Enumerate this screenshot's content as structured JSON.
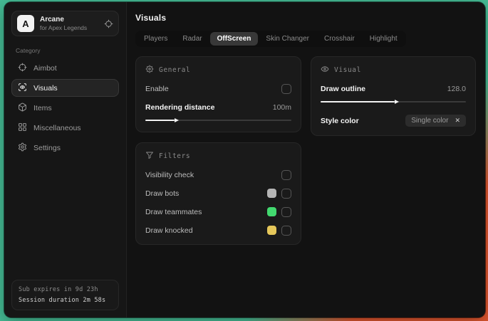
{
  "sidebar": {
    "logo_letter": "A",
    "app_name": "Arcane",
    "app_subtitle": "for Apex Legends",
    "category_label": "Category",
    "items": [
      {
        "label": "Aimbot",
        "icon": "crosshair-icon"
      },
      {
        "label": "Visuals",
        "icon": "scan-eye-icon"
      },
      {
        "label": "Items",
        "icon": "package-icon"
      },
      {
        "label": "Miscellaneous",
        "icon": "grid-icon"
      },
      {
        "label": "Settings",
        "icon": "gear-icon"
      }
    ],
    "footer": {
      "line1": "Sub expires in 9d 23h",
      "line2": "Session duration 2m 58s"
    }
  },
  "main": {
    "title": "Visuals",
    "tabs": [
      {
        "label": "Players"
      },
      {
        "label": "Radar"
      },
      {
        "label": "OffScreen",
        "active": true
      },
      {
        "label": "Skin Changer"
      },
      {
        "label": "Crosshair"
      },
      {
        "label": "Highlight"
      }
    ],
    "general": {
      "title": "General",
      "enable_label": "Enable",
      "enable_checked": false,
      "distance_label": "Rendering distance",
      "distance_value": "100m",
      "distance_percent": 20
    },
    "visual": {
      "title": "Visual",
      "outline_label": "Draw outline",
      "outline_value": "128.0",
      "outline_percent": 51,
      "style_label": "Style color",
      "style_value": "Single color",
      "clear_glyph": "✕"
    },
    "filters": {
      "title": "Filters",
      "rows": [
        {
          "label": "Visibility check",
          "checked": false
        },
        {
          "label": "Draw bots",
          "swatch": "#b5b5b5",
          "checked": false
        },
        {
          "label": "Draw teammates",
          "swatch": "#42d96f",
          "checked": false
        },
        {
          "label": "Draw knocked",
          "swatch": "#e5c75a",
          "checked": false
        }
      ]
    }
  },
  "colors": {
    "wallpaper_teal": "#45bc95",
    "wallpaper_orange": "#e0572f",
    "swatch_gray": "#b5b5b5",
    "swatch_green": "#42d96f",
    "swatch_yellow": "#e5c75a"
  }
}
